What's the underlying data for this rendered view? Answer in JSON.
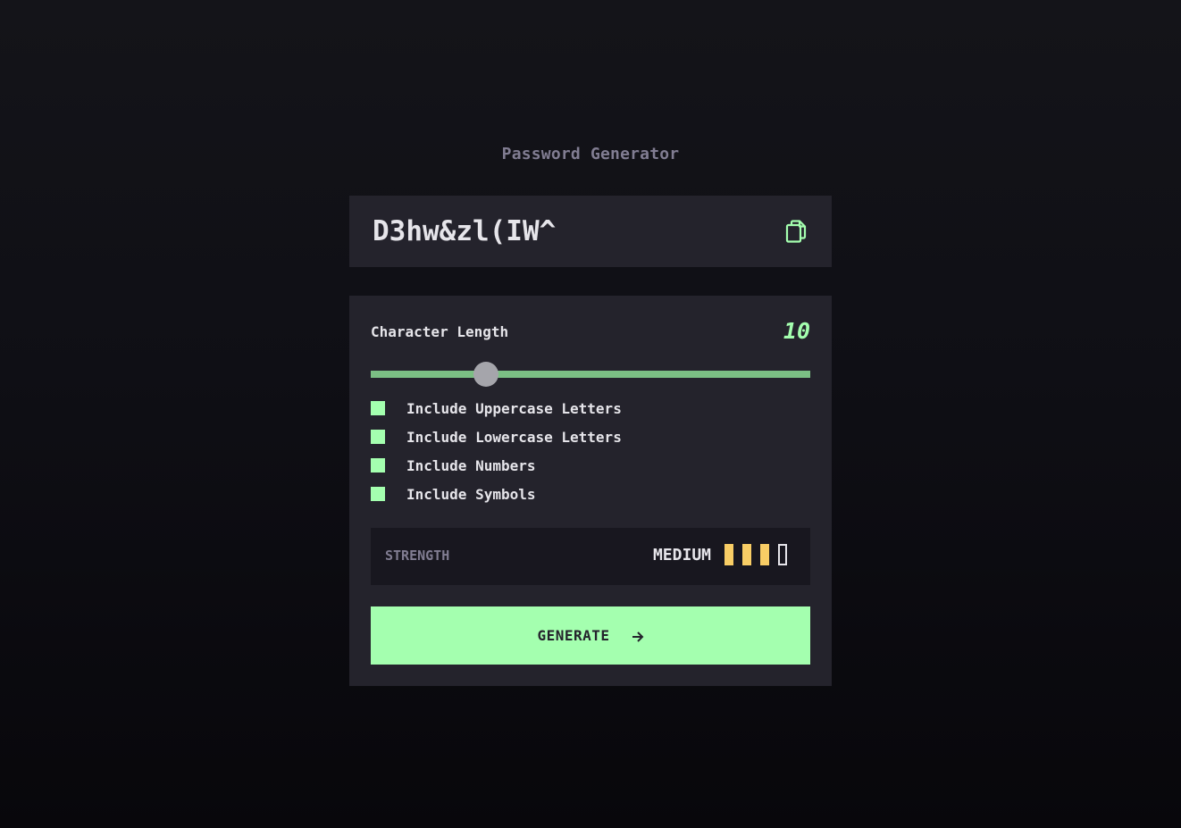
{
  "app": {
    "title": "Password Generator"
  },
  "password": {
    "value": "D3hw&zl(IW^",
    "copy_icon": "copy-icon"
  },
  "length": {
    "label": "Character Length",
    "value": "10",
    "min": 0,
    "max": 38,
    "current": 10
  },
  "options": [
    {
      "label": "Include Uppercase Letters",
      "checked": true
    },
    {
      "label": "Include Lowercase Letters",
      "checked": true
    },
    {
      "label": "Include Numbers",
      "checked": true
    },
    {
      "label": "Include Symbols",
      "checked": true
    }
  ],
  "strength": {
    "label": "STRENGTH",
    "value": "MEDIUM",
    "level": 3,
    "max_level": 4
  },
  "generate": {
    "label": "GENERATE",
    "icon": "arrow-right-icon"
  },
  "colors": {
    "accent": "#a4ffaf",
    "strength_medium": "#f8cd65",
    "panel": "#24232c",
    "muted": "#817d92"
  }
}
